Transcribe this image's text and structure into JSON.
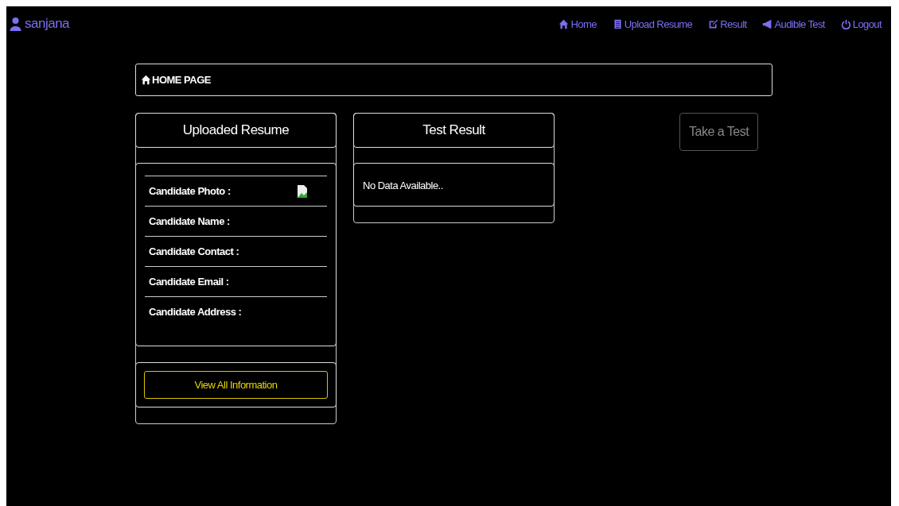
{
  "user": {
    "name": "sanjana"
  },
  "nav": [
    {
      "label": "Home"
    },
    {
      "label": "Upload Resume"
    },
    {
      "label": "Result"
    },
    {
      "label": "Audible Test"
    },
    {
      "label": "Logout"
    }
  ],
  "page_title": "HOME PAGE",
  "resume_card": {
    "title": "Uploaded Resume",
    "fields": [
      {
        "label": "Candidate Photo :",
        "kind": "photo"
      },
      {
        "label": "Candidate Name :",
        "kind": "text"
      },
      {
        "label": "Candidate Contact :",
        "kind": "text"
      },
      {
        "label": "Candidate Email :",
        "kind": "text"
      },
      {
        "label": "Candidate Address :",
        "kind": "text"
      }
    ],
    "button": "View All Information"
  },
  "result_card": {
    "title": "Test Result",
    "message": "No Data Available.."
  },
  "test_button": {
    "label": "Take a Test",
    "disabled": true
  }
}
